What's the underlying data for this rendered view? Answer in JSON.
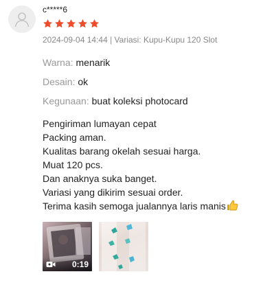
{
  "review": {
    "username": "c*****6",
    "rating": 5,
    "rating_max": 5,
    "meta": "2024-09-04 14:44 | Variasi: Kupu-Kupu 120 Slot",
    "attributes": [
      {
        "label": "Warna:",
        "value": "menarik"
      },
      {
        "label": "Desain:",
        "value": "ok"
      },
      {
        "label": "Kegunaan:",
        "value": "buat koleksi photocard"
      }
    ],
    "comment_lines": [
      "Pengiriman lumayan cepat",
      "Packing aman.",
      "Kualitas barang okelah sesuai harga.",
      "Muat 120 pcs.",
      "Dan anaknya suka banget.",
      "Variasi yang dikirim sesuai order.",
      "Terima kasih semoga jualannya laris manis"
    ],
    "media": {
      "video_duration": "0:19"
    }
  },
  "colors": {
    "star": "#ee4d2d",
    "avatar_bg": "#eeeeee",
    "avatar_icon": "#c4c4c4",
    "meta_text": "#888888",
    "label_text": "#999999"
  },
  "icons": [
    "user-avatar-icon",
    "star-icon",
    "thumbs-up-emoji",
    "video-camera-icon"
  ]
}
